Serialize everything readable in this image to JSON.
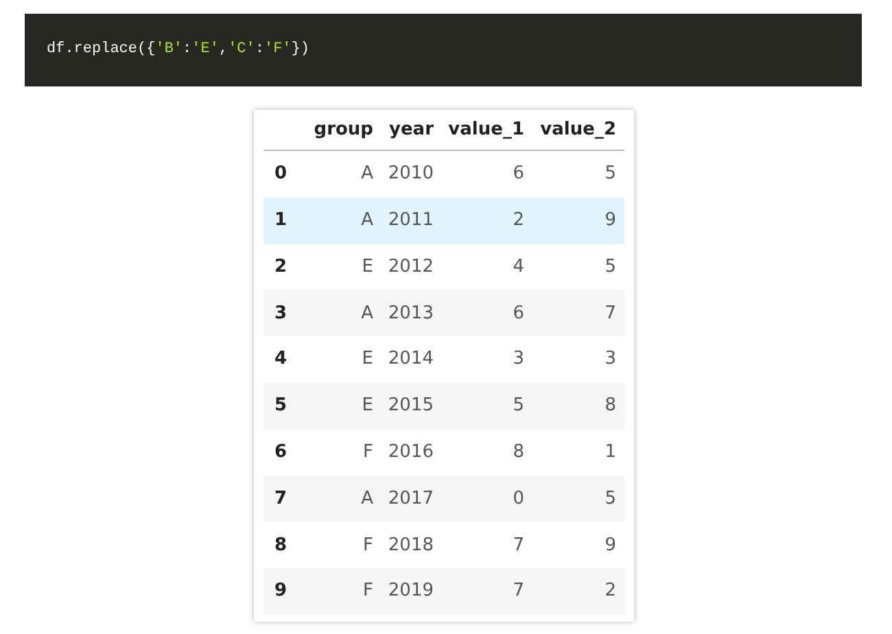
{
  "code": {
    "tokens": [
      {
        "text": "df.replace({",
        "kind": "plain"
      },
      {
        "text": "'B'",
        "kind": "string"
      },
      {
        "text": ":",
        "kind": "plain"
      },
      {
        "text": "'E'",
        "kind": "string"
      },
      {
        "text": ",",
        "kind": "plain"
      },
      {
        "text": "'C'",
        "kind": "string"
      },
      {
        "text": ":",
        "kind": "plain"
      },
      {
        "text": "'F'",
        "kind": "string"
      },
      {
        "text": "})",
        "kind": "plain"
      }
    ]
  },
  "table": {
    "columns": [
      "group",
      "year",
      "value_1",
      "value_2"
    ],
    "rows": [
      {
        "index": "0",
        "cells": [
          "A",
          "2010",
          "6",
          "5"
        ],
        "selected": false
      },
      {
        "index": "1",
        "cells": [
          "A",
          "2011",
          "2",
          "9"
        ],
        "selected": true
      },
      {
        "index": "2",
        "cells": [
          "E",
          "2012",
          "4",
          "5"
        ],
        "selected": false
      },
      {
        "index": "3",
        "cells": [
          "A",
          "2013",
          "6",
          "7"
        ],
        "selected": false
      },
      {
        "index": "4",
        "cells": [
          "E",
          "2014",
          "3",
          "3"
        ],
        "selected": false
      },
      {
        "index": "5",
        "cells": [
          "E",
          "2015",
          "5",
          "8"
        ],
        "selected": false
      },
      {
        "index": "6",
        "cells": [
          "F",
          "2016",
          "8",
          "1"
        ],
        "selected": false
      },
      {
        "index": "7",
        "cells": [
          "A",
          "2017",
          "0",
          "5"
        ],
        "selected": false
      },
      {
        "index": "8",
        "cells": [
          "F",
          "2018",
          "7",
          "9"
        ],
        "selected": false
      },
      {
        "index": "9",
        "cells": [
          "F",
          "2019",
          "7",
          "2"
        ],
        "selected": false
      }
    ]
  }
}
